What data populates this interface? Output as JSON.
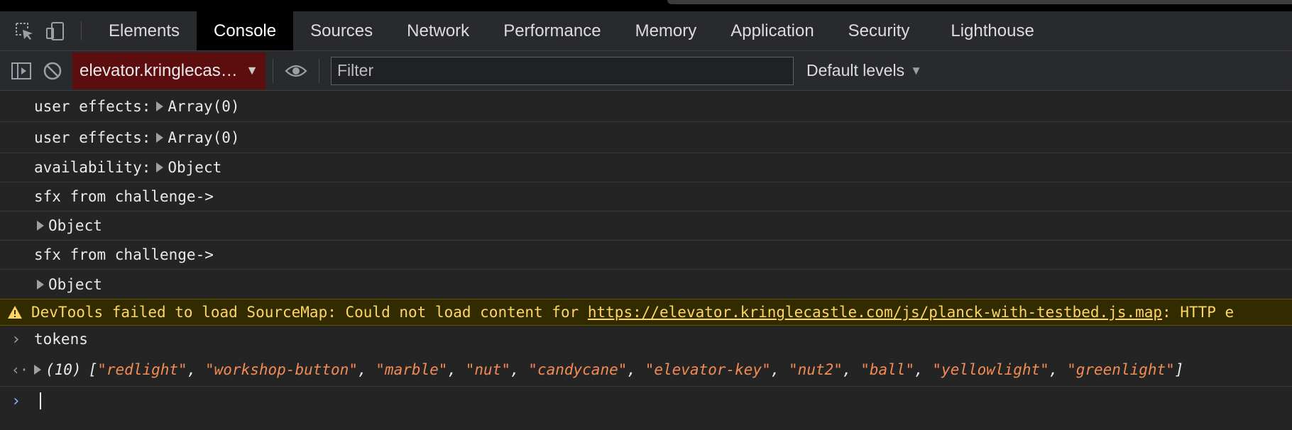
{
  "tabs": [
    {
      "label": "Elements"
    },
    {
      "label": "Console"
    },
    {
      "label": "Sources"
    },
    {
      "label": "Network"
    },
    {
      "label": "Performance"
    },
    {
      "label": "Memory"
    },
    {
      "label": "Application"
    },
    {
      "label": "Security"
    },
    {
      "label": "Lighthouse"
    }
  ],
  "active_tab": "Console",
  "toolbar": {
    "context": "elevator.kringlecas…",
    "filter_placeholder": "Filter",
    "levels": "Default levels"
  },
  "console": {
    "logs": [
      {
        "prefix": "user effects:",
        "value": "Array(0)"
      },
      {
        "prefix": "user effects:",
        "value": "Array(0)"
      },
      {
        "prefix": "availability:",
        "value": "Object"
      },
      {
        "text": "sfx from challenge->"
      },
      {
        "value": "Object"
      },
      {
        "text": "sfx from challenge->"
      },
      {
        "value": "Object"
      }
    ],
    "warning": {
      "prefix": "DevTools failed to load SourceMap: Could not load content for ",
      "url": "https://elevator.kringlecastle.com/js/planck-with-testbed.js.map",
      "suffix": ": HTTP e"
    },
    "input": "tokens",
    "result": {
      "count": "(10)",
      "items": [
        "redlight",
        "workshop-button",
        "marble",
        "nut",
        "candycane",
        "elevator-key",
        "nut2",
        "ball",
        "yellowlight",
        "greenlight"
      ]
    }
  },
  "colors": {
    "accent_context": "#5c0d0d",
    "string": "#f28b54",
    "warning_text": "#fdd663",
    "prompt_blue": "#8ab4f8"
  }
}
